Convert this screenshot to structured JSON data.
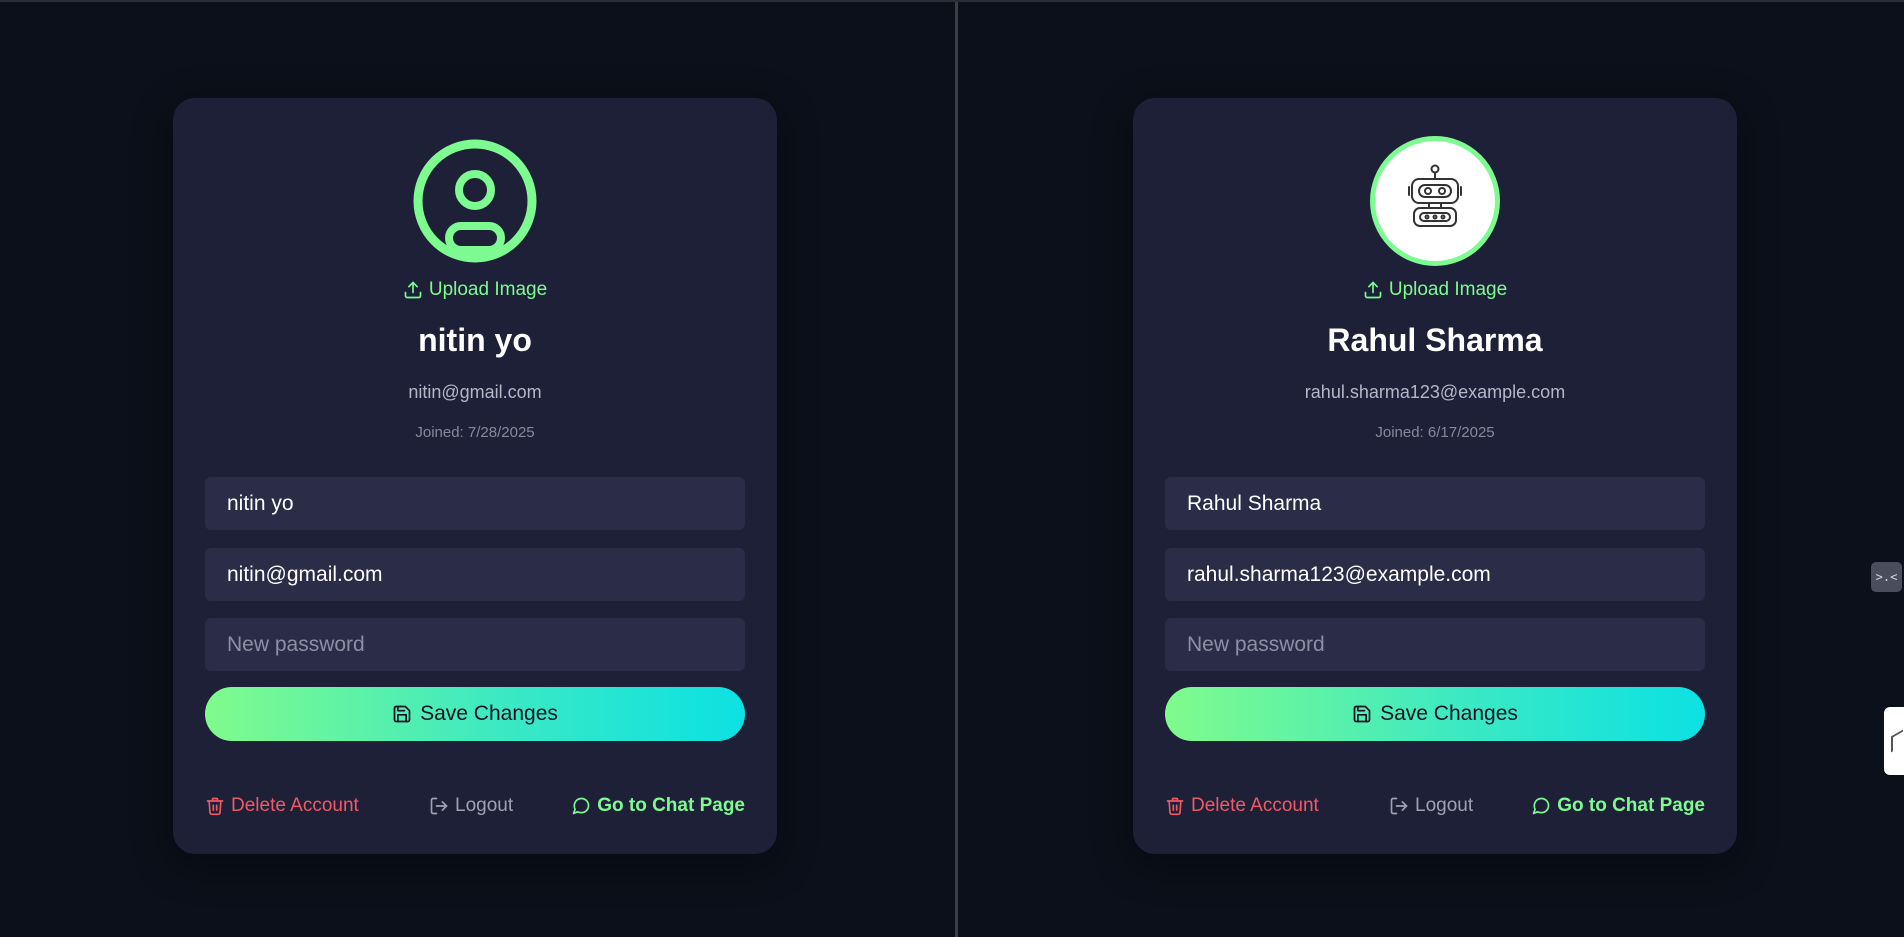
{
  "accent_color": "#7dfb91",
  "danger_color": "#f05a66",
  "panels": [
    {
      "avatar": "default-user-icon",
      "upload_label": "Upload Image",
      "display_name": "nitin yo",
      "display_email": "nitin@gmail.com",
      "joined": "Joined: 7/28/2025",
      "name_value": "nitin yo",
      "email_value": "nitin@gmail.com",
      "password_placeholder": "New password",
      "save_label": "Save Changes",
      "delete_label": "Delete Account",
      "logout_label": "Logout",
      "chat_label": "Go to Chat Page"
    },
    {
      "avatar": "robot-icon",
      "upload_label": "Upload Image",
      "display_name": "Rahul Sharma",
      "display_email": "rahul.sharma123@example.com",
      "joined": "Joined: 6/17/2025",
      "name_value": "Rahul Sharma",
      "email_value": "rahul.sharma123@example.com",
      "password_placeholder": "New password",
      "save_label": "Save Changes",
      "delete_label": "Delete Account",
      "logout_label": "Logout",
      "chat_label": "Go to Chat Page"
    }
  ],
  "edge_widget_text": ">.<"
}
